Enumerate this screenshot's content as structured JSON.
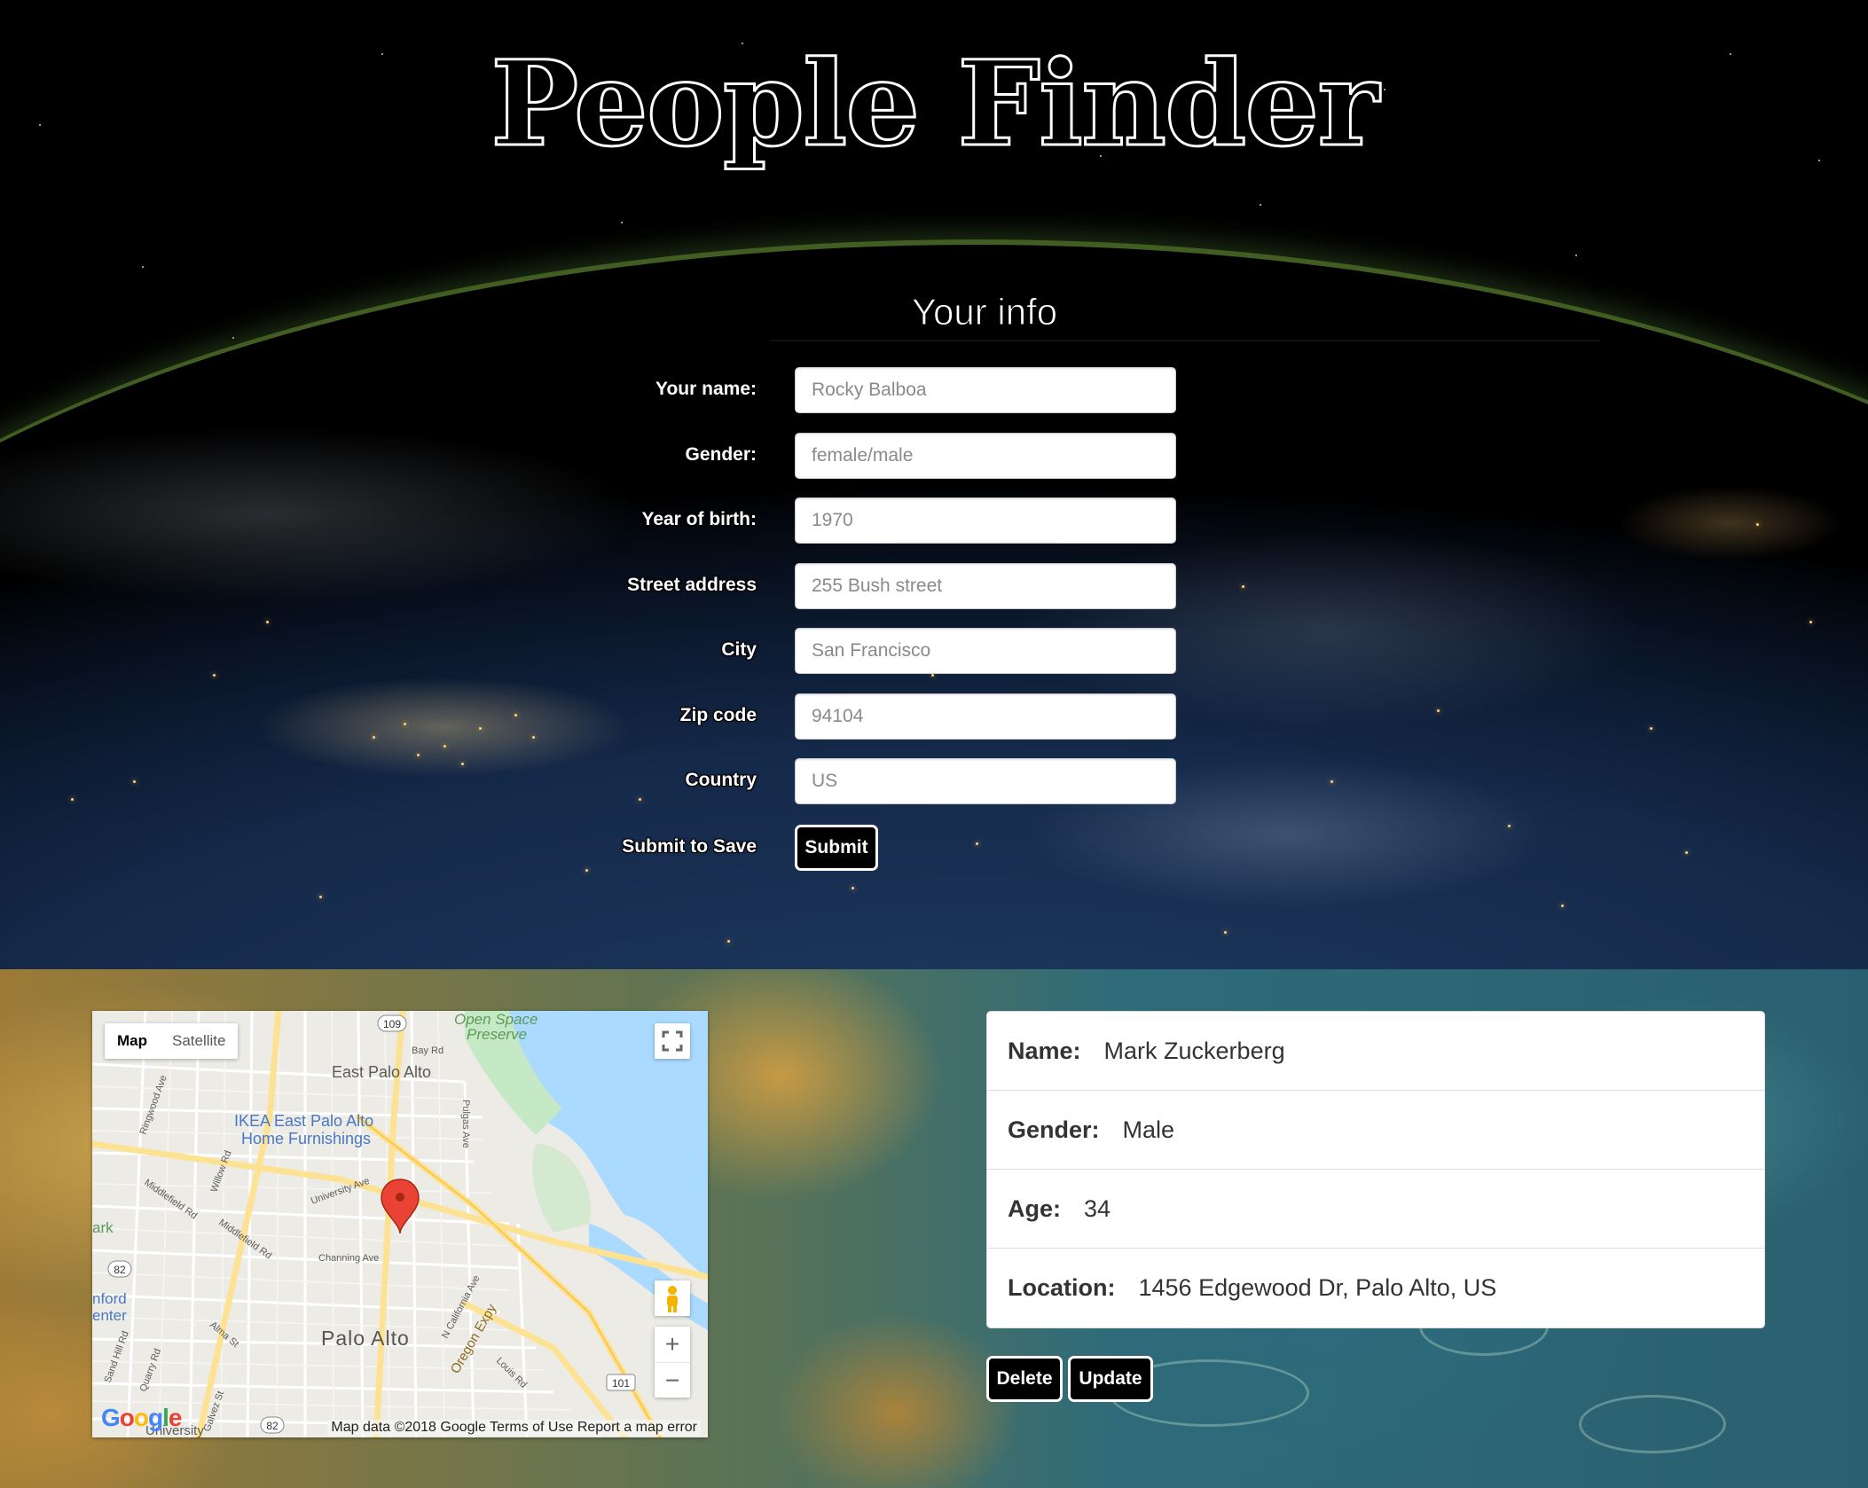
{
  "page": {
    "title": "People Finder",
    "section_title": "Your info"
  },
  "form": {
    "fields": [
      {
        "label": "Your name:",
        "placeholder": "Rocky Balboa"
      },
      {
        "label": "Gender:",
        "placeholder": "female/male"
      },
      {
        "label": "Year of birth:",
        "placeholder": "1970"
      },
      {
        "label": "Street address",
        "placeholder": "255 Bush street"
      },
      {
        "label": "City",
        "placeholder": "San Francisco"
      },
      {
        "label": "Zip code",
        "placeholder": "94104"
      },
      {
        "label": "Country",
        "placeholder": "US"
      }
    ],
    "submit_label": "Submit to Save",
    "submit_button": "Submit"
  },
  "map": {
    "type_map": "Map",
    "type_satellite": "Satellite",
    "fullscreen_icon": "fullscreen-icon",
    "pegman_icon": "pegman-icon",
    "zoom_in": "+",
    "zoom_out": "−",
    "logo": "Google",
    "attribution": "Map data ©2018 Google   Terms of Use   Report a map error",
    "labels": {
      "open_space": "Open Space",
      "preserve": "Preserve",
      "east_palo_alto": "East Palo Alto",
      "ikea_1": "IKEA East Palo Alto",
      "ikea_2": "Home Furnishings",
      "palo_alto": "Palo Alto",
      "stanford_1": "nford",
      "stanford_2": "enter",
      "ark": "ark",
      "university": "University Ave",
      "channing": "Channing Ave",
      "oregon": "Oregon Expy",
      "middlefield": "Middlefield Rd",
      "middlefield2": "Middlefield Rd",
      "ringwood": "Ringwood Ave",
      "willow": "Willow Rd",
      "pulgas": "Pulgas Ave",
      "bay_rd": "Bay Rd",
      "alma": "Alma St",
      "n_california": "N California Ave",
      "louis": "Louis Rd",
      "sand_hill": "Sand Hill Rd",
      "quarry": "Quarry Rd",
      "galvez": "Galvez St",
      "stanford_univ": "University",
      "hwy_109": "109",
      "hwy_82": "82",
      "hwy_82b": "82",
      "hwy_101": "101"
    },
    "colors": {
      "land": "#ecebe6",
      "water": "#aadaff",
      "park": "#c5e8c5",
      "highway": "#fde293",
      "pin": "#ea4335"
    }
  },
  "person": {
    "name_key": "Name:",
    "name_value": "Mark Zuckerberg",
    "gender_key": "Gender:",
    "gender_value": "Male",
    "age_key": "Age:",
    "age_value": "34",
    "location_key": "Location:",
    "location_value": "1456 Edgewood Dr, Palo Alto, US"
  },
  "actions": {
    "delete": "Delete",
    "update": "Update"
  }
}
